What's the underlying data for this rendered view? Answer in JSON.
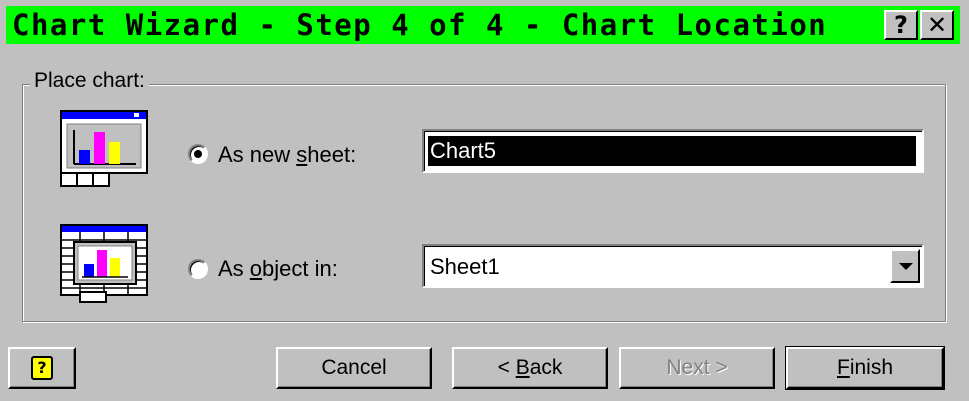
{
  "window": {
    "title": "Chart Wizard - Step 4 of 4 - Chart Location",
    "help_glyph": "?",
    "close_glyph": "✕",
    "titlebar_color": "#00ff00"
  },
  "group": {
    "label": "Place chart:"
  },
  "options": {
    "new_sheet": {
      "label_pre": "As new ",
      "label_mnemonic": "s",
      "label_post": "heet:",
      "selected": true,
      "value": "Chart5",
      "icon": "chart-new-sheet-icon"
    },
    "as_object": {
      "label_pre": "As ",
      "label_mnemonic": "o",
      "label_post": "bject in:",
      "selected": false,
      "value": "Sheet1",
      "icon": "chart-embedded-object-icon"
    }
  },
  "buttons": {
    "help": "?",
    "cancel": "Cancel",
    "back_pre": "< ",
    "back_mnemonic": "B",
    "back_post": "ack",
    "next": "Next >",
    "finish_mnemonic": "F",
    "finish_post": "inish"
  },
  "colors": {
    "face": "#c0c0c0",
    "bar_blue": "#0000ff",
    "bar_magenta": "#ff00ff",
    "bar_yellow": "#ffff00",
    "titlebar_icon_blue": "#0000ff"
  }
}
